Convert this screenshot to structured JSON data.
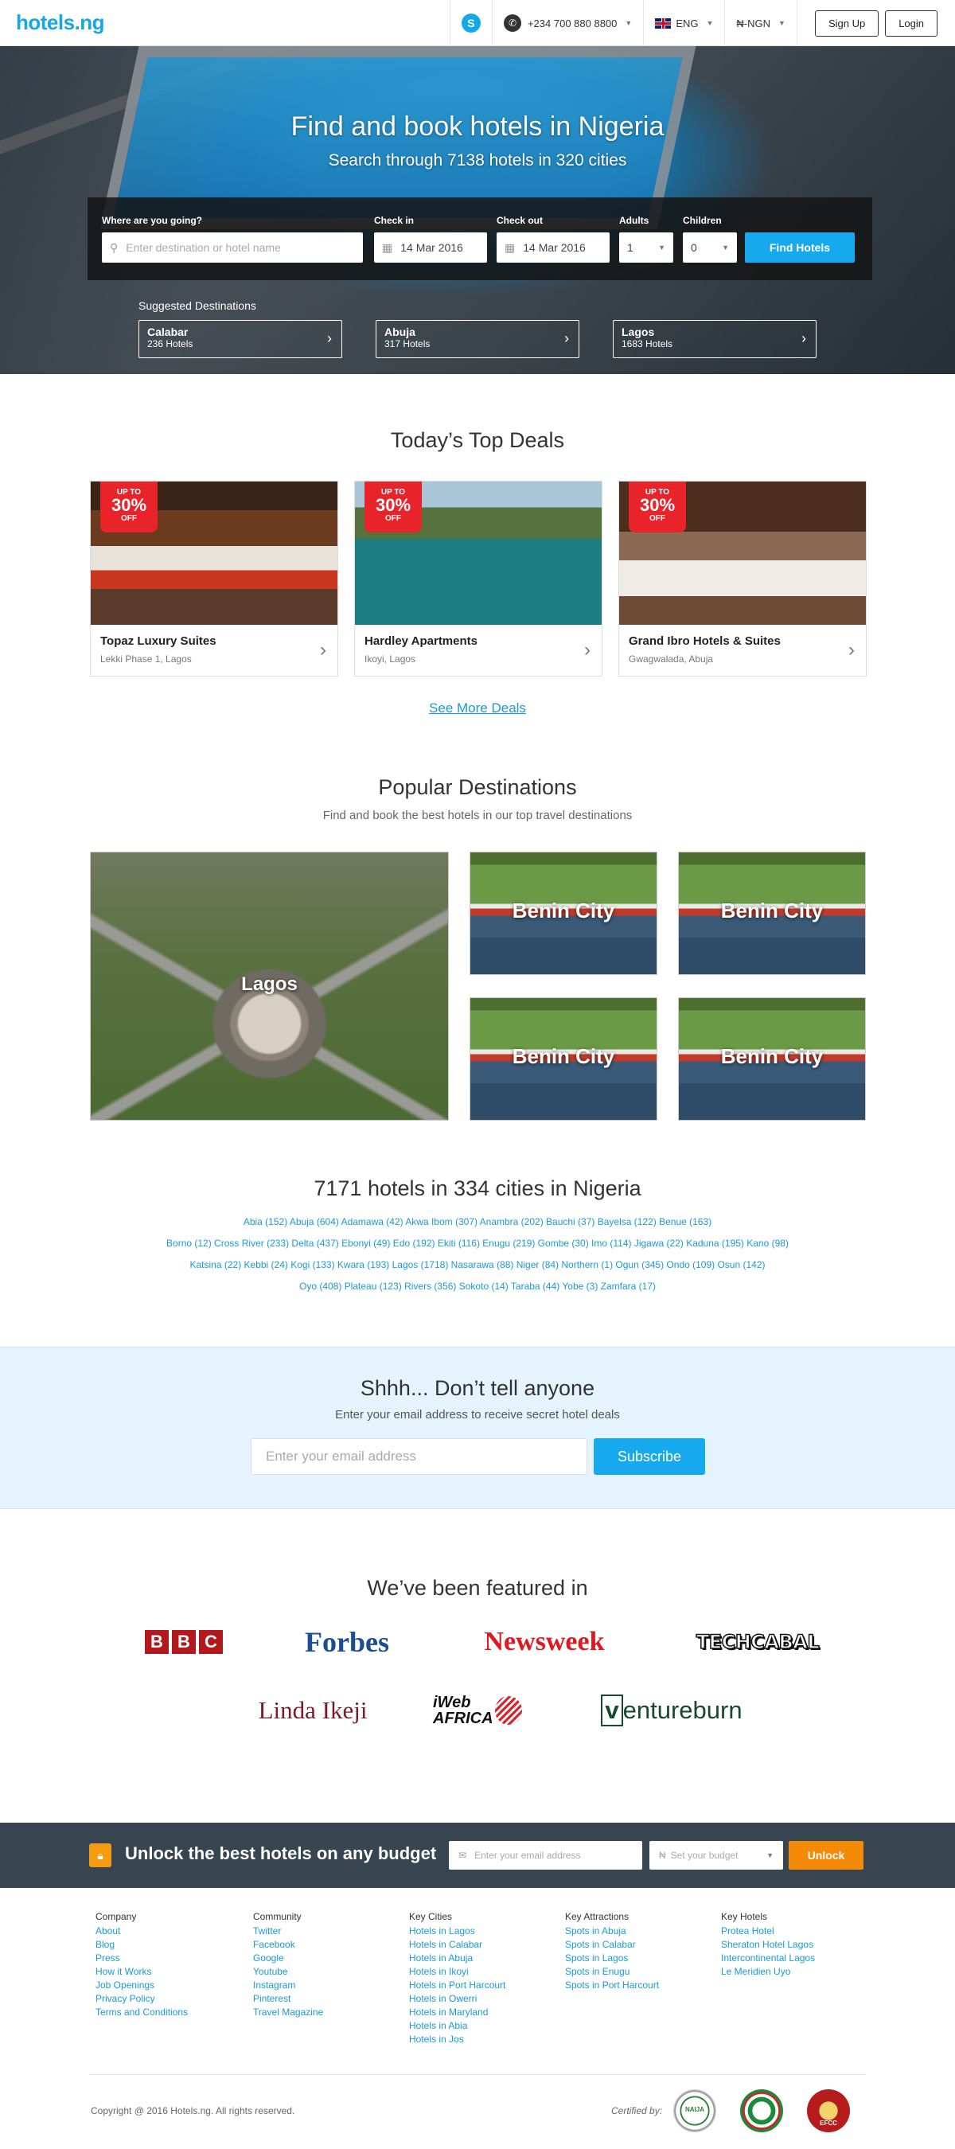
{
  "header": {
    "logo": "hotels.ng",
    "phone": "+234 700 880 8800",
    "language": "ENG",
    "currency": "₦-NGN",
    "signup": "Sign Up",
    "login": "Login"
  },
  "hero": {
    "title": "Find and book hotels in Nigeria",
    "subtitle": "Search through 7138 hotels in 320 cities",
    "search": {
      "destination_label": "Where are you going?",
      "destination_placeholder": "Enter destination  or hotel name",
      "checkin_label": "Check in",
      "checkin_value": "14 Mar 2016",
      "checkout_label": "Check out",
      "checkout_value": "14 Mar 2016",
      "adults_label": "Adults",
      "adults_value": "1",
      "children_label": "Children",
      "children_value": "0",
      "button": "Find Hotels"
    },
    "suggested_title": "Suggested Destinations",
    "suggested": [
      {
        "name": "Calabar",
        "count": "236 Hotels"
      },
      {
        "name": "Abuja",
        "count": "317 Hotels"
      },
      {
        "name": "Lagos",
        "count": "1683 Hotels"
      }
    ]
  },
  "deals": {
    "title": "Today’s Top Deals",
    "badge": {
      "top": "UP TO",
      "pct": "30%",
      "bottom": "OFF"
    },
    "items": [
      {
        "name": "Topaz Luxury Suites",
        "location": "Lekki Phase 1, Lagos"
      },
      {
        "name": "Hardley Apartments",
        "location": "Ikoyi, Lagos"
      },
      {
        "name": "Grand Ibro Hotels & Suites",
        "location": "Gwagwalada, Abuja"
      }
    ],
    "see_more": "See More Deals"
  },
  "destinations": {
    "title": "Popular Destinations",
    "subtitle": "Find and book the best hotels in our top travel destinations",
    "items": [
      "Lagos",
      "Benin City",
      "Benin City",
      "Benin City",
      "Benin City"
    ]
  },
  "cities": {
    "title": "7171 hotels in 334 cities in Nigeria",
    "lines": [
      "Abia (152) Abuja (604) Adamawa (42) Akwa Ibom (307) Anambra (202) Bauchi (37) Bayelsa (122) Benue (163)",
      "Borno (12) Cross River (233) Delta (437) Ebonyi (49) Edo (192) Ekiti (116) Enugu (219) Gombe (30) Imo (114) Jigawa (22) Kaduna (195) Kano (98)",
      "Katsina (22) Kebbi (24) Kogi (133) Kwara (193) Lagos (1718) Nasarawa (88) Niger (84) Northern (1) Ogun (345) Ondo (109) Osun (142)",
      "Oyo (408) Plateau (123) Rivers (356) Sokoto (14) Taraba (44) Yobe (3) Zamfara (17)"
    ]
  },
  "newsletter": {
    "title": "Shhh... Don’t tell anyone",
    "subtitle": "Enter your email address to receive secret hotel deals",
    "placeholder": "Enter your email address",
    "button": "Subscribe"
  },
  "featured": {
    "title": "We’ve been featured in",
    "logos": {
      "bbc": [
        "B",
        "B",
        "C"
      ],
      "forbes": "Forbes",
      "newsweek": "Newsweek",
      "techcabal": "TECHCABAL",
      "linda": "Linda Ikeji",
      "iweb_1": "iWeb",
      "iweb_2": "AFRICA",
      "venture_v": "v",
      "venture_rest": "entureburn"
    }
  },
  "unlock": {
    "title": "Unlock the best hotels on any budget",
    "email_placeholder": "Enter your email address",
    "budget_placeholder": "Set your budget",
    "currency_symbol": "₦",
    "button": "Unlock"
  },
  "footer": {
    "columns": [
      {
        "heading": "Company",
        "links": [
          "About",
          "Blog",
          "Press",
          "How it Works",
          "Job Openings",
          "Privacy Policy",
          "Terms and Conditions"
        ]
      },
      {
        "heading": "Community",
        "links": [
          "Twitter",
          "Facebook",
          "Google",
          "Youtube",
          "Instagram",
          "Pinterest",
          "Travel Magazine"
        ]
      },
      {
        "heading": "Key Cities",
        "links": [
          "Hotels in Lagos",
          "Hotels in Calabar",
          "Hotels in Abuja",
          "Hotels in Ikoyi",
          "Hotels in Port Harcourt",
          "Hotels in Owerri",
          "Hotels in Maryland",
          "Hotels in Abia",
          "Hotels in Jos"
        ]
      },
      {
        "heading": "Key Attractions",
        "links": [
          "Spots in Abuja",
          "Spots in Calabar",
          "Spots in Lagos",
          "Spots in Enugu",
          "Spots in Port Harcourt"
        ]
      },
      {
        "heading": "Key Hotels",
        "links": [
          "Protea Hotel",
          "Sheraton Hotel Lagos",
          "Intercontinental Lagos",
          "Le Meridien Uyo"
        ]
      }
    ],
    "copyright": "Copyright @ 2016 Hotels.ng. All rights reserved.",
    "certified": "Certified by:",
    "seals": [
      "NAIJA",
      "",
      "EFCC"
    ]
  },
  "colors": {
    "brand": "#17a6e6",
    "deal_badge": "#e8232a",
    "unlock_bar": "#36454f",
    "unlock_button": "#f58a07",
    "newsletter_bg": "#e5f4fc"
  }
}
